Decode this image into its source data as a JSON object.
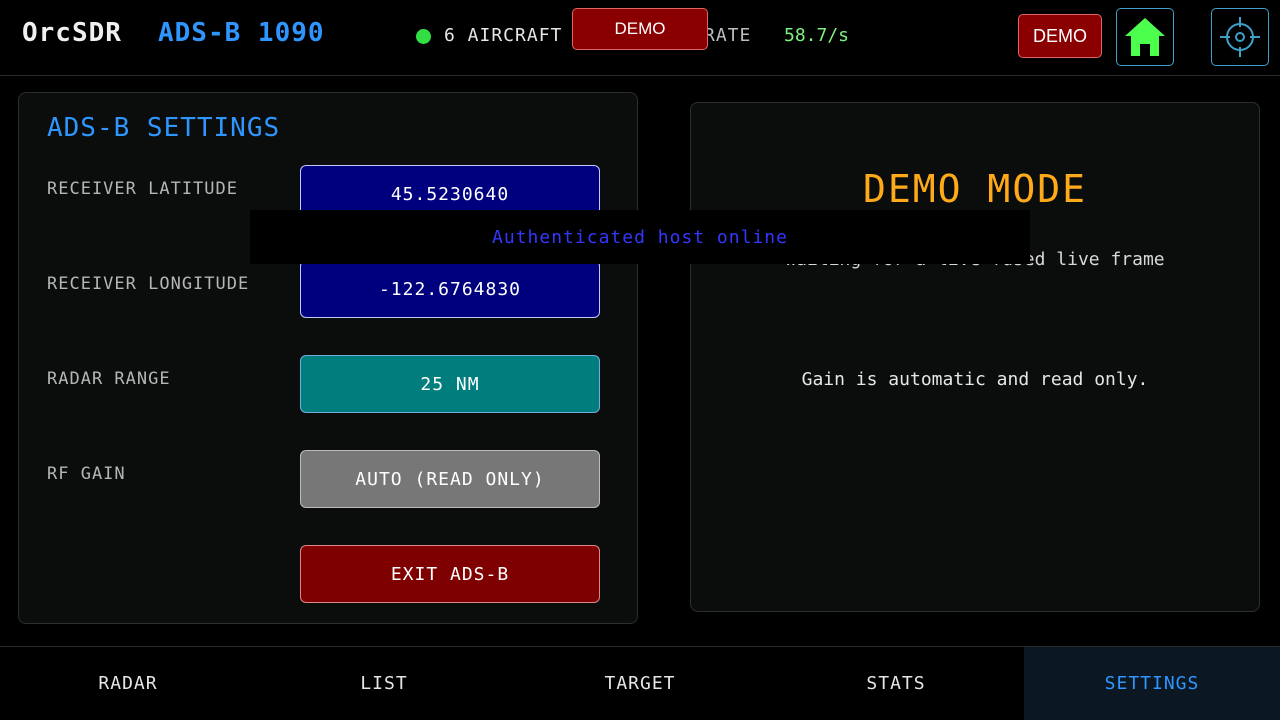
{
  "header": {
    "brand": "OrcSDR",
    "mode": "ADS-B 1090",
    "aircraft_count": "6 AIRCRAFT",
    "rate_label": "RATE",
    "rate_value": "58.7/s",
    "demo_badge_center": "DEMO",
    "demo_badge_right": "DEMO",
    "home_icon": "home-icon",
    "locate_icon": "crosshair-icon",
    "status_color": "#33dd44"
  },
  "settings": {
    "title": "ADS-B SETTINGS",
    "latitude_label": "RECEIVER LATITUDE",
    "latitude_value": "45.5230640",
    "longitude_label": "RECEIVER LONGITUDE",
    "longitude_value": "-122.6764830",
    "range_label": "RADAR RANGE",
    "range_value": "25 NM",
    "gain_label": "RF GAIN",
    "gain_value": "AUTO  (READ ONLY)",
    "exit_label": "EXIT ADS-B"
  },
  "demo_panel": {
    "title": "DEMO MODE",
    "waiting_text": "Waiting for a live-fused live frame",
    "gain_note": "Gain is automatic and read only."
  },
  "toast": {
    "message": "Authenticated host online"
  },
  "nav": {
    "tabs": [
      {
        "label": "RADAR"
      },
      {
        "label": "LIST"
      },
      {
        "label": "TARGET"
      },
      {
        "label": "STATS"
      },
      {
        "label": "SETTINGS"
      }
    ],
    "active": "SETTINGS",
    "accent": "#2f96ff"
  }
}
